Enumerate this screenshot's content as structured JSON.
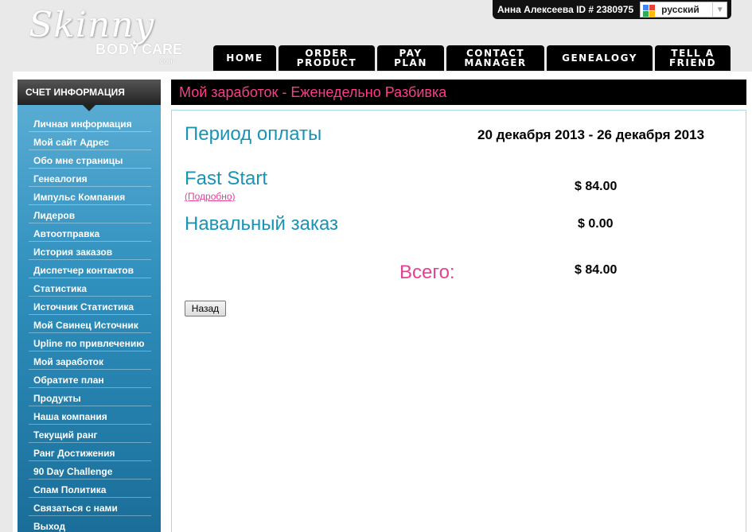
{
  "logo": {
    "script": "Skinny",
    "word1": "BODY",
    "word2": "CARE",
    "dotcom": ".com"
  },
  "user": {
    "name": "Анна Алексеева ID # 2380975"
  },
  "language": {
    "selected": "русский"
  },
  "nav": [
    "HOME",
    "ORDER PRODUCT",
    "PAY PLAN",
    "CONTACT MANAGER",
    "GENEALOGY",
    "TELL A FRIEND"
  ],
  "sidebar": {
    "heading": "СЧЕТ ИНФОРМАЦИЯ",
    "items": [
      "Личная информация",
      "Мой сайт Адрес",
      "Обо мне страницы",
      "Генеалогия",
      "Импульс Компания",
      "Лидеров",
      "Автоотправка",
      "История заказов",
      "Диспетчер контактов",
      "Статистика",
      "Источник Статистика",
      "Мой Свинец Источник",
      "Upline по привлечению",
      "Мой заработок",
      "Обратите план",
      "Продукты",
      "Наша компания",
      "Текущий ранг",
      "Ранг Достижения",
      "90 Day Challenge",
      "Спам Политика",
      "Связаться с нами",
      "Выход"
    ]
  },
  "main": {
    "title": "Мой заработок - Еженедельно Разбивка",
    "period_label": "Период оплаты",
    "period_value": "20 декабря 2013 - 26 декабря 2013",
    "fast_start_label": "Fast Start",
    "fast_start_detail": "(Подробно)",
    "fast_start_amount": "$ 84.00",
    "bulk_label": "Навальный заказ",
    "bulk_amount": "$ 0.00",
    "total_label": "Всего:",
    "total_amount": "$ 84.00",
    "back_button": "Назад"
  },
  "colors": {
    "accent_pink": "#e63f96",
    "heading_blue": "#1a93b5",
    "sidebar_blue": "#2f8fbd"
  }
}
